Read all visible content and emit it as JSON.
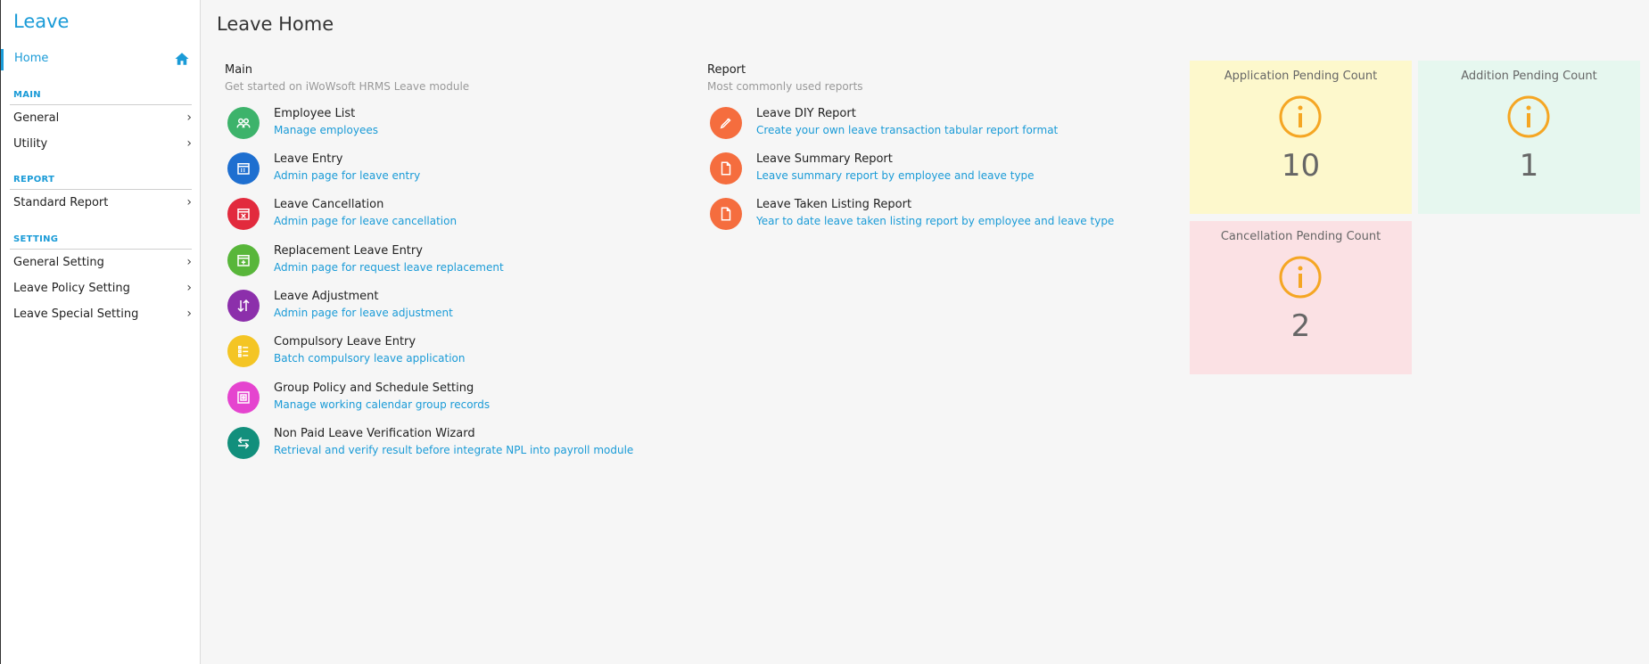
{
  "app": {
    "title": "Leave"
  },
  "sidebar": {
    "home": {
      "label": "Home",
      "icon": "home-icon"
    },
    "sections": [
      {
        "header": "MAIN",
        "items": [
          {
            "label": "General"
          },
          {
            "label": "Utility"
          }
        ]
      },
      {
        "header": "REPORT",
        "items": [
          {
            "label": "Standard Report"
          }
        ]
      },
      {
        "header": "SETTING",
        "items": [
          {
            "label": "General Setting"
          },
          {
            "label": "Leave Policy Setting"
          },
          {
            "label": "Leave Special Setting"
          }
        ]
      }
    ]
  },
  "page": {
    "title": "Leave Home"
  },
  "main_group": {
    "title": "Main",
    "subtitle": "Get started on iWoWsoft HRMS Leave module",
    "items": [
      {
        "title": "Employee List",
        "desc": "Manage employees",
        "color": "#3db36b",
        "icon": "people-icon"
      },
      {
        "title": "Leave Entry",
        "desc": "Admin page for leave entry",
        "color": "#1e6fd0",
        "icon": "calendar-icon"
      },
      {
        "title": "Leave Cancellation",
        "desc": "Admin page for leave cancellation",
        "color": "#e22a3d",
        "icon": "calendar-cancel-icon"
      },
      {
        "title": "Replacement Leave Entry",
        "desc": "Admin page for request leave replacement",
        "color": "#58b63a",
        "icon": "calendar-add-icon"
      },
      {
        "title": "Leave Adjustment",
        "desc": "Admin page for leave adjustment",
        "color": "#8c2fab",
        "icon": "swap-vertical-icon"
      },
      {
        "title": "Compulsory Leave Entry",
        "desc": "Batch compulsory leave application",
        "color": "#f4c524",
        "icon": "list-icon"
      },
      {
        "title": "Group Policy and Schedule Setting",
        "desc": "Manage working calendar group records",
        "color": "#e544cf",
        "icon": "schedule-icon"
      },
      {
        "title": "Non Paid Leave Verification Wizard",
        "desc": "Retrieval and verify result before integrate NPL into payroll module",
        "color": "#128f7c",
        "icon": "transfer-icon"
      }
    ]
  },
  "report_group": {
    "title": "Report",
    "subtitle": "Most commonly used reports",
    "items": [
      {
        "title": "Leave DIY Report",
        "desc": "Create your own leave transaction tabular report format",
        "color": "#f56d3e",
        "icon": "pen-icon"
      },
      {
        "title": "Leave Summary Report",
        "desc": "Leave summary report by employee and leave type",
        "color": "#f56d3e",
        "icon": "document-icon"
      },
      {
        "title": "Leave Taken Listing Report",
        "desc": "Year to date leave taken listing report by employee and leave type",
        "color": "#f56d3e",
        "icon": "document-icon"
      }
    ]
  },
  "cards": [
    {
      "title": "Application Pending Count",
      "value": "10",
      "bg": "#fdf8cc",
      "icon": "info-icon"
    },
    {
      "title": "Addition Pending Count",
      "value": "1",
      "bg": "#e6f7ef",
      "icon": "info-icon"
    },
    {
      "title": "Cancellation Pending Count",
      "value": "2",
      "bg": "#fbe1e4",
      "icon": "info-icon"
    }
  ],
  "colors": {
    "accent": "#1a9bd7",
    "info_icon": "#f5a623"
  }
}
